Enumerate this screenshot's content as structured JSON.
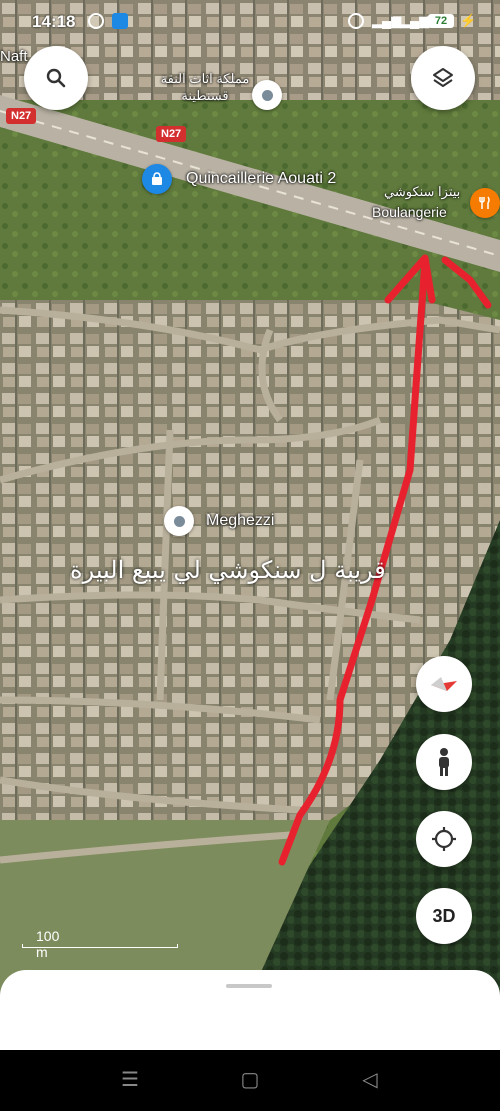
{
  "status_bar": {
    "time": "14:18",
    "battery": "72"
  },
  "map": {
    "labels": {
      "naft_partial": "Naft",
      "quincaillerie": "Quincaillerie Aouati 2",
      "boulangerie": "Boulangerie",
      "boulangerie_ar": "بيتزا سنكوشي",
      "meghezzi": "Meghezzi",
      "arabic_shop": "مملكة اثاث النقة قسنطينة"
    },
    "road_shields": [
      "N27",
      "N27"
    ],
    "handwritten_note": "قريبة ل سنكوشي لي يبيع البيرة",
    "scale_label": "100 m"
  },
  "buttons": {
    "search": "search-icon",
    "layers": "layers-icon",
    "compass": "compass-icon",
    "street_view": "pegman-icon",
    "my_location": "crosshair-icon",
    "three_d": "3D"
  },
  "colors": {
    "annotation": "#e8212f",
    "road_shield": "#d32f2f",
    "poi_shop": "#1e88e5",
    "poi_food": "#f57c00"
  }
}
